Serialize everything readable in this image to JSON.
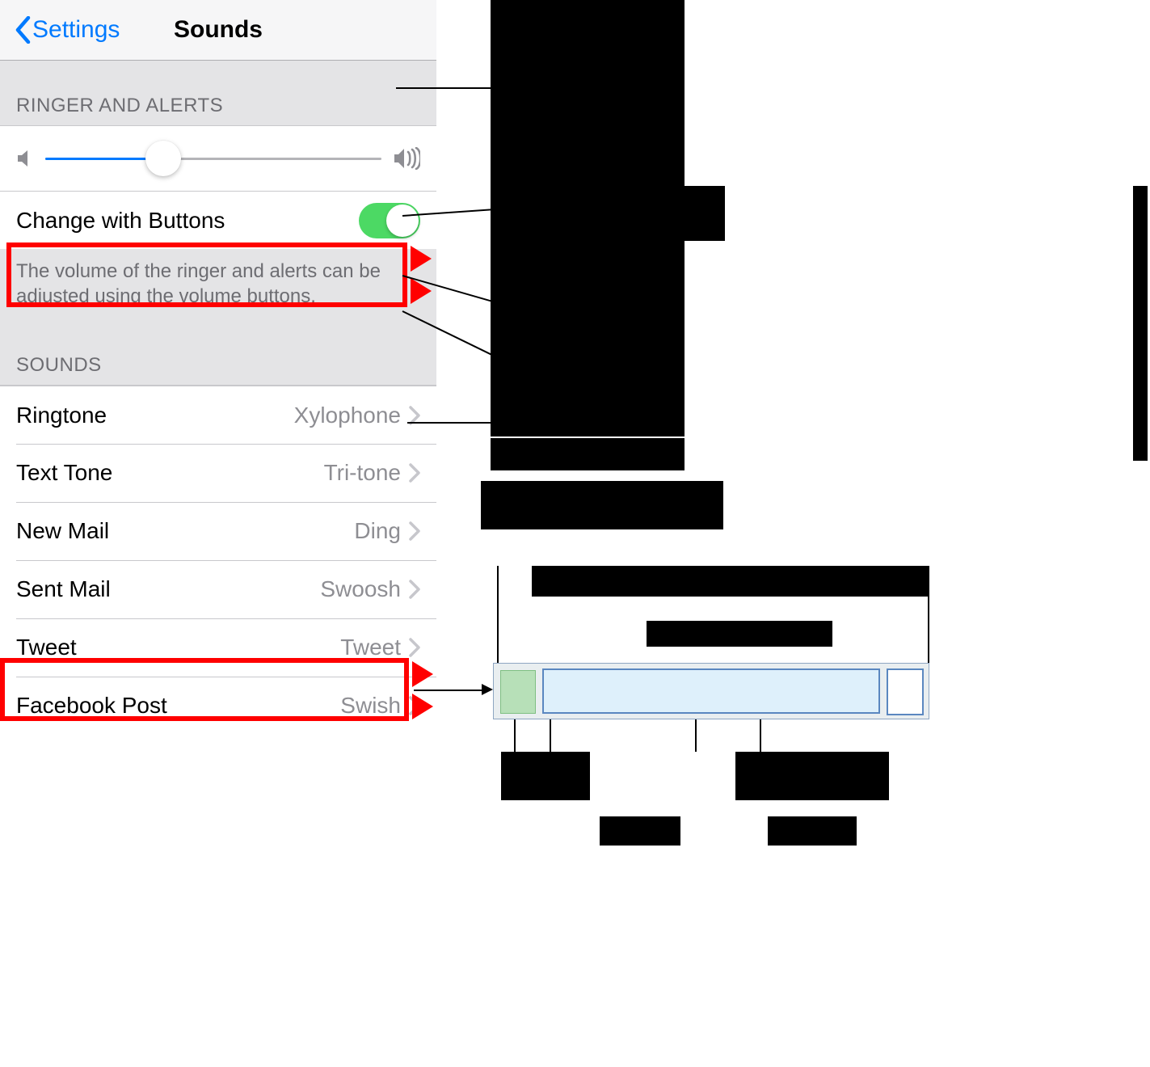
{
  "nav": {
    "back_label": "Settings",
    "title": "Sounds"
  },
  "ringer": {
    "header": "RINGER AND ALERTS",
    "volume_percent": 35,
    "change_with_buttons_label": "Change with Buttons",
    "change_with_buttons_on": true,
    "footer": "The volume of the ringer and alerts can be adjusted using the volume buttons."
  },
  "sounds": {
    "header": "SOUNDS",
    "rows": [
      {
        "label": "Ringtone",
        "value": "Xylophone"
      },
      {
        "label": "Text Tone",
        "value": "Tri-tone"
      },
      {
        "label": "New Mail",
        "value": "Ding"
      },
      {
        "label": "Sent Mail",
        "value": "Swoosh"
      },
      {
        "label": "Tweet",
        "value": "Tweet"
      },
      {
        "label": "Facebook Post",
        "value": "Swish"
      }
    ]
  }
}
